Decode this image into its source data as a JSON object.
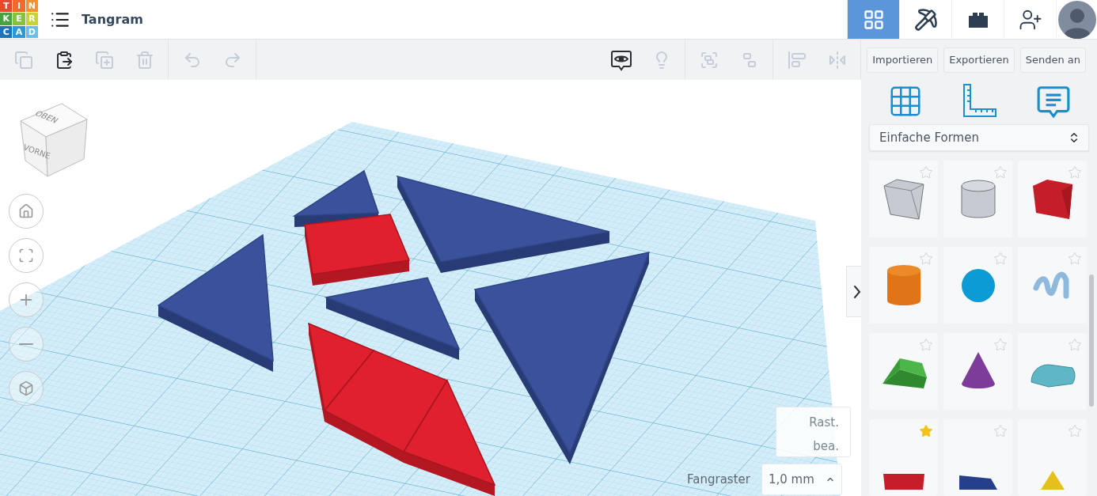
{
  "app_bar": {
    "logo_letters": [
      {
        "text": "T",
        "color": "#e8492b"
      },
      {
        "text": "I",
        "color": "#f06a2c"
      },
      {
        "text": "N",
        "color": "#f5922f"
      },
      {
        "text": "K",
        "color": "#47a33f"
      },
      {
        "text": "E",
        "color": "#86c23f"
      },
      {
        "text": "R",
        "color": "#c8d436"
      },
      {
        "text": "C",
        "color": "#1b73ba"
      },
      {
        "text": "A",
        "color": "#2c98d5"
      },
      {
        "text": "D",
        "color": "#6bbfe7"
      }
    ],
    "title": "Tangram",
    "tabs": [
      {
        "kind": "grid",
        "selected": true
      },
      {
        "kind": "pickaxe",
        "selected": false
      },
      {
        "kind": "brick",
        "selected": false
      },
      {
        "kind": "add_user",
        "selected": false
      }
    ]
  },
  "toolbar": {
    "tools": [
      {
        "kind": "copy",
        "disabled": true
      },
      {
        "kind": "paste",
        "disabled": false
      },
      {
        "kind": "duplicate",
        "disabled": true
      },
      {
        "kind": "delete",
        "disabled": true
      },
      {
        "kind": "undo",
        "disabled": true
      },
      {
        "kind": "redo",
        "disabled": true
      },
      {
        "kind": "notes",
        "disabled": false
      },
      {
        "kind": "bulb",
        "disabled": true
      },
      {
        "kind": "group",
        "disabled": true
      },
      {
        "kind": "ungroup",
        "disabled": true
      },
      {
        "kind": "align",
        "disabled": true
      },
      {
        "kind": "mirror",
        "disabled": true
      }
    ],
    "buttons": [
      "Importieren",
      "Exportieren",
      "Senden an"
    ]
  },
  "view_cube": {
    "top": "OBEN",
    "front": "VORNE"
  },
  "nav_buttons": [
    {
      "kind": "home"
    },
    {
      "kind": "fit"
    },
    {
      "kind": "zoom_in"
    },
    {
      "kind": "zoom_out"
    },
    {
      "kind": "perspective"
    }
  ],
  "grid_controls": {
    "edit_grid": "Rast. bea.",
    "snap_label": "Fangraster",
    "snap_value": "1,0 mm"
  },
  "panel": {
    "tools": [
      {
        "kind": "workplane"
      },
      {
        "kind": "ruler"
      },
      {
        "kind": "notes"
      }
    ],
    "category": "Einfache Formen",
    "shapes": [
      {
        "kind": "box_hole",
        "starred": false
      },
      {
        "kind": "cylinder_hole",
        "starred": false
      },
      {
        "kind": "box",
        "starred": false
      },
      {
        "kind": "cylinder",
        "starred": false
      },
      {
        "kind": "sphere",
        "starred": false
      },
      {
        "kind": "scribble",
        "starred": false
      },
      {
        "kind": "roof",
        "starred": false
      },
      {
        "kind": "cone",
        "starred": false
      },
      {
        "kind": "round_roof",
        "starred": false
      },
      {
        "kind": "text",
        "starred": true
      },
      {
        "kind": "wedge",
        "starred": false
      },
      {
        "kind": "pyramid",
        "starred": false
      }
    ]
  }
}
